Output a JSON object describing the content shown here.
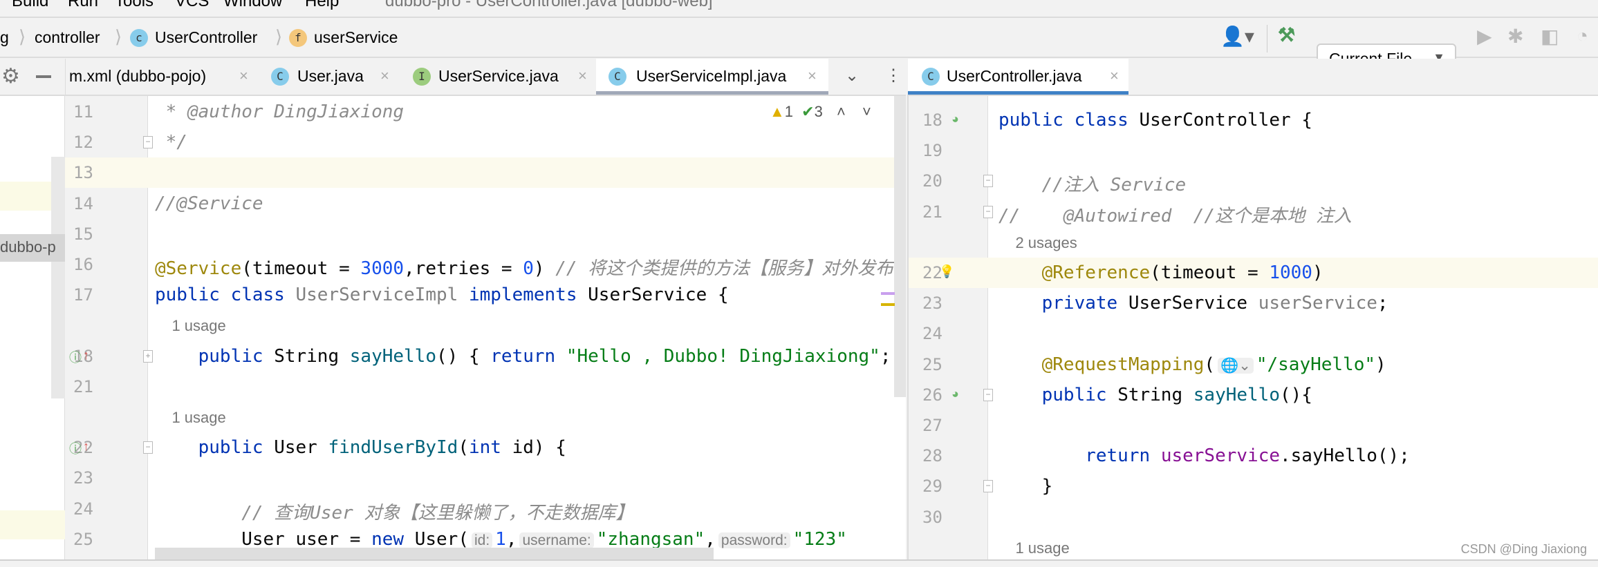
{
  "window": {
    "menu": [
      "Build",
      "Run",
      "Tools",
      "VCS",
      "Window",
      "Help"
    ],
    "title": "dubbo-pro - UserController.java [dubbo-web]"
  },
  "breadcrumb": [
    "g",
    "controller",
    "UserController",
    "userService"
  ],
  "toolbar": {
    "run_config": "Current File",
    "icons": [
      "user-icon",
      "build-hammer-icon",
      "run-icon",
      "debug-icon",
      "coverage-icon",
      "profiler-icon"
    ]
  },
  "left_tabs": [
    {
      "label": "m.xml (dubbo-pojo)",
      "icon": ""
    },
    {
      "label": "User.java",
      "icon": "C"
    },
    {
      "label": "UserService.java",
      "icon": "I"
    },
    {
      "label": "UserServiceImpl.java",
      "icon": "C",
      "active": true
    }
  ],
  "right_tabs": [
    {
      "label": "UserController.java",
      "icon": "C",
      "active": true
    }
  ],
  "project_panel": {
    "label": "dubbo-p"
  },
  "inspection": {
    "warnings": "1",
    "typos": "3"
  },
  "left_editor": {
    "lines": [
      {
        "n": "11",
        "tokens": [
          [
            " * ",
            "cmt"
          ],
          [
            "@author",
            "cmt"
          ],
          [
            " DingJiaxiong",
            "cmt"
          ]
        ]
      },
      {
        "n": "12",
        "tokens": [
          [
            " */",
            "cmt"
          ]
        ]
      },
      {
        "n": "13",
        "tokens": [],
        "current": true
      },
      {
        "n": "14",
        "tokens": [
          [
            "//@Service",
            "cmt"
          ]
        ]
      },
      {
        "n": "15",
        "tokens": []
      },
      {
        "n": "16",
        "tokens": [
          [
            "@Service",
            "ann"
          ],
          [
            "(timeout = ",
            ""
          ],
          [
            "3000",
            "num"
          ],
          [
            ",retries = ",
            ""
          ],
          [
            "0",
            "num"
          ],
          [
            ") ",
            ""
          ],
          [
            "// 将这个类提供的方法【服务】对外发布,",
            "cmt"
          ]
        ]
      },
      {
        "n": "17",
        "tokens": [
          [
            "public class ",
            "kw"
          ],
          [
            "UserServiceImpl ",
            "unused"
          ],
          [
            "implements ",
            "kw"
          ],
          [
            "UserService {",
            ""
          ]
        ]
      },
      {
        "usage": "    1 usage"
      },
      {
        "n": "18",
        "tokens": [
          [
            "    public ",
            "kw"
          ],
          [
            "String ",
            ""
          ],
          [
            "sayHello",
            "mth"
          ],
          [
            "() { ",
            ""
          ],
          [
            "return ",
            "kw"
          ],
          [
            "\"Hello , Dubbo! DingJiaxiong\"",
            "str"
          ],
          [
            "; }",
            ""
          ]
        ]
      },
      {
        "n": "21",
        "tokens": []
      },
      {
        "usage": "    1 usage"
      },
      {
        "n": "22",
        "tokens": [
          [
            "    public ",
            "kw"
          ],
          [
            "User ",
            ""
          ],
          [
            "findUserById",
            "mth"
          ],
          [
            "(",
            ""
          ],
          [
            "int ",
            "kw"
          ],
          [
            "id) {",
            ""
          ]
        ]
      },
      {
        "n": "23",
        "tokens": []
      },
      {
        "n": "24",
        "tokens": [
          [
            "        // 查询User 对象【这里躲懒了，不走数据库】",
            "cmt"
          ]
        ]
      },
      {
        "n": "25",
        "tokens": [
          [
            "        User user = ",
            ""
          ],
          [
            "new ",
            "kw"
          ],
          [
            "User(",
            ""
          ],
          [
            "id:",
            "hint"
          ],
          [
            "1",
            "num"
          ],
          [
            ",",
            ""
          ],
          [
            "username:",
            "hint"
          ],
          [
            "\"zhangsan\"",
            "str"
          ],
          [
            ",",
            ""
          ],
          [
            "password:",
            "hint"
          ],
          [
            "\"123\"",
            "str"
          ]
        ]
      }
    ]
  },
  "right_editor": {
    "lines": [
      {
        "n": "18",
        "tokens": [
          [
            "public class ",
            "kw"
          ],
          [
            "UserController {",
            ""
          ]
        ]
      },
      {
        "n": "19",
        "tokens": []
      },
      {
        "n": "20",
        "tokens": [
          [
            "    //注入 Service",
            "cmt"
          ]
        ]
      },
      {
        "n": "21",
        "tokens": [
          [
            "//    @Autowired  //这个是本地 注入",
            "cmt"
          ]
        ]
      },
      {
        "usage": "    2 usages"
      },
      {
        "n": "22",
        "tokens": [
          [
            "    @Reference",
            "ann"
          ],
          [
            "(timeout = ",
            ""
          ],
          [
            "1000",
            "num"
          ],
          [
            ")",
            ""
          ]
        ],
        "current": true
      },
      {
        "n": "23",
        "tokens": [
          [
            "    private ",
            "kw"
          ],
          [
            "UserService ",
            ""
          ],
          [
            "userService",
            "unused"
          ],
          [
            ";",
            ""
          ]
        ]
      },
      {
        "n": "24",
        "tokens": []
      },
      {
        "n": "25",
        "tokens": [
          [
            "    @RequestMapping",
            "ann"
          ],
          [
            "(",
            ""
          ],
          [
            "🌐⌄",
            "hint"
          ],
          [
            "\"/sayHello\"",
            "str"
          ],
          [
            ")",
            ""
          ]
        ]
      },
      {
        "n": "26",
        "tokens": [
          [
            "    public ",
            "kw"
          ],
          [
            "String ",
            ""
          ],
          [
            "sayHello",
            "mth"
          ],
          [
            "(){",
            ""
          ]
        ]
      },
      {
        "n": "27",
        "tokens": []
      },
      {
        "n": "28",
        "tokens": [
          [
            "        return ",
            "kw"
          ],
          [
            "userService",
            "fld"
          ],
          [
            ".sayHello();",
            ""
          ]
        ]
      },
      {
        "n": "29",
        "tokens": [
          [
            "    }",
            ""
          ]
        ]
      },
      {
        "n": "30",
        "tokens": []
      },
      {
        "usage": "    1 usage"
      }
    ]
  },
  "watermark": "CSDN @Ding Jiaxiong",
  "colors": {
    "keyword": "#0033b3",
    "annotation": "#9e880d",
    "string": "#067d17",
    "number": "#1750eb",
    "comment": "#8c8c8c",
    "active_tab_right": "#3f81c6"
  }
}
